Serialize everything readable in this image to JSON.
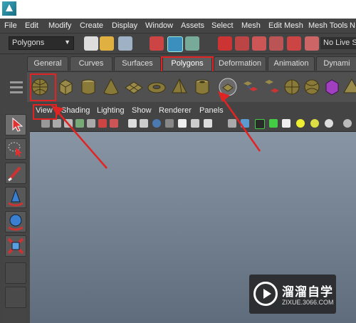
{
  "menubar": {
    "items": [
      "File",
      "Edit",
      "Modify",
      "Create",
      "Display",
      "Window",
      "Assets",
      "Select",
      "Mesh",
      "Edit Mesh",
      "Mesh Tools",
      "N"
    ]
  },
  "statusline": {
    "mode": "Polygons",
    "live_surface": "No Live Su"
  },
  "shelf_tabs": [
    "General",
    "Curves",
    "Surfaces",
    "Polygons",
    "Deformation",
    "Animation",
    "Dynami"
  ],
  "active_tab": "Polygons",
  "shelf_icons": [
    "poly-sphere-icon",
    "poly-cube-icon",
    "poly-cylinder-icon",
    "poly-cone-icon",
    "poly-plane-icon",
    "poly-torus-icon",
    "poly-pyramid-icon",
    "poly-pipe-icon",
    "poly-platonic-icon",
    "combine-icon",
    "separate-icon",
    "extract-icon",
    "smooth-icon",
    "boolean-icon",
    "mirror-icon"
  ],
  "tool_icons": [
    "select-tool-icon",
    "lasso-tool-icon",
    "paint-select-tool-icon",
    "move-tool-icon",
    "rotate-tool-icon",
    "scale-tool-icon"
  ],
  "panel_menu": [
    "View",
    "Shading",
    "Lighting",
    "Show",
    "Renderer",
    "Panels"
  ],
  "watermark": {
    "title": "溜溜自学",
    "subtitle": "ZIXUE.3066.COM"
  }
}
